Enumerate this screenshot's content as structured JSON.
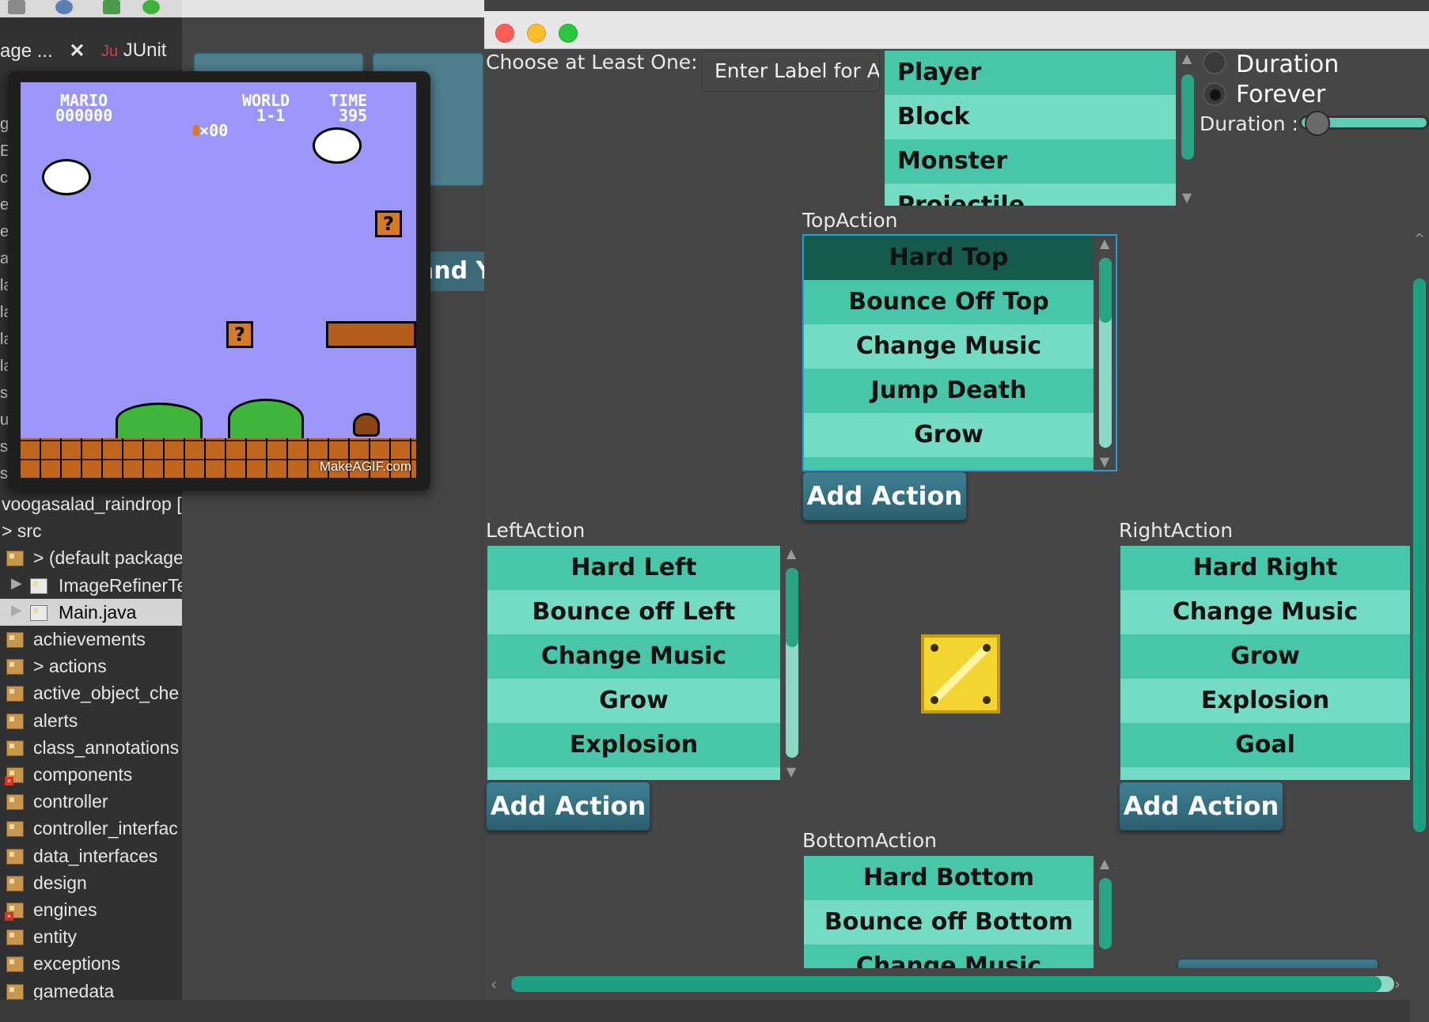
{
  "ide": {
    "tabs": [
      {
        "label": "age ..."
      },
      {
        "label": "JUnit"
      }
    ],
    "close_glyph": "✕",
    "edge_letters": [
      "g",
      "E",
      "c",
      "e",
      "e",
      "a",
      "la",
      "la",
      "la",
      "la",
      "s",
      "u",
      "s",
      "s"
    ],
    "explorer_items": [
      {
        "label": "voogasalad_raindrop [",
        "kind": "project"
      },
      {
        "label": "> src",
        "kind": "folder"
      },
      {
        "label": "> (default package",
        "kind": "package"
      },
      {
        "label": "ImageRefinerTe",
        "kind": "file"
      },
      {
        "label": "Main.java",
        "kind": "file",
        "selected": true
      },
      {
        "label": "achievements",
        "kind": "package"
      },
      {
        "label": "> actions",
        "kind": "package"
      },
      {
        "label": "active_object_che",
        "kind": "package"
      },
      {
        "label": "alerts",
        "kind": "package"
      },
      {
        "label": "class_annotations",
        "kind": "package"
      },
      {
        "label": "components",
        "kind": "package",
        "error": true
      },
      {
        "label": "controller",
        "kind": "package"
      },
      {
        "label": "controller_interfac",
        "kind": "package"
      },
      {
        "label": "data_interfaces",
        "kind": "package"
      },
      {
        "label": "design",
        "kind": "package"
      },
      {
        "label": "engines",
        "kind": "package",
        "error": true
      },
      {
        "label": "entity",
        "kind": "package"
      },
      {
        "label": "exceptions",
        "kind": "package"
      },
      {
        "label": "gamedata",
        "kind": "package"
      }
    ],
    "background_label": "and Y"
  },
  "mario_preview": {
    "hud_mario": "MARIO\n000000",
    "hud_coins": "×00",
    "hud_world": "WORLD\n 1-1",
    "hud_time": "TIME\n 395",
    "watermark": "MakeAGIF.com",
    "question_mark": "?"
  },
  "editor": {
    "choose_label": "Choose at Least One:",
    "label_field_value": "Enter Label for A",
    "type_list": [
      "Player",
      "Block",
      "Monster",
      "Projectile"
    ],
    "radio_duration": "Duration",
    "radio_forever": "Forever",
    "radio_selected": "Forever",
    "duration_label": "Duration :",
    "duration_slider_value": 0.05,
    "top": {
      "title": "TopAction",
      "items": [
        "Hard Top",
        "Bounce Off Top",
        "Change Music",
        "Jump Death",
        "Grow"
      ],
      "selected": "Hard Top",
      "button": "Add Action"
    },
    "left": {
      "title": "LeftAction",
      "items": [
        "Hard Left",
        "Bounce off Left",
        "Change Music",
        "Grow",
        "Explosion"
      ],
      "button": "Add Action"
    },
    "right": {
      "title": "RightAction",
      "items": [
        "Hard Right",
        "Change Music",
        "Grow",
        "Explosion",
        "Goal"
      ],
      "button": "Add Action"
    },
    "bottom": {
      "title": "BottomAction",
      "items": [
        "Hard Bottom",
        "Bounce off Bottom",
        "Change Music"
      ]
    },
    "preview_icon": "block-icon",
    "colors": {
      "list_item_light": "#74dcc4",
      "list_item_dark": "#47c6a9",
      "selected_item": "#155a4d",
      "button": "#2b6070",
      "focus_border": "#26a0da",
      "scroll_thumb": "#1d9f83"
    }
  }
}
